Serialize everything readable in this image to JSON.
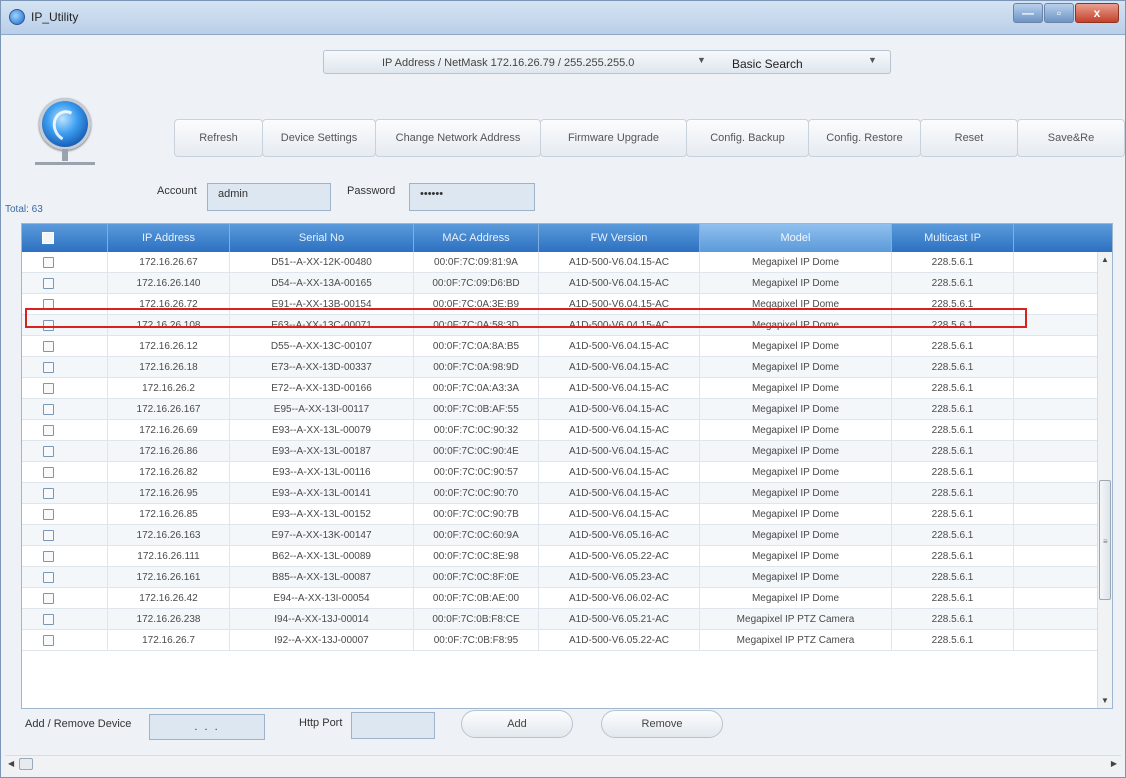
{
  "window": {
    "title": "IP_Utility",
    "controls": {
      "minimize": "—",
      "maximize": "▫",
      "close": "x"
    }
  },
  "search": {
    "ip_netmask": "IP Address / NetMask  172.16.26.79 / 255.255.255.0",
    "mode": "Basic Search"
  },
  "toolbar": {
    "buttons": [
      "Refresh",
      "Device Settings",
      "Change Network Address",
      "Firmware Upgrade",
      "Config. Backup",
      "Config. Restore",
      "Reset",
      "Save&Re"
    ]
  },
  "account": {
    "account_label": "Account",
    "account_value": "admin",
    "password_label": "Password",
    "password_value": "••••••"
  },
  "total": "Total: 63",
  "table": {
    "headers": [
      "IP Address",
      "Serial No",
      "MAC Address",
      "FW Version",
      "Model",
      "Multicast IP"
    ],
    "highlighted_row": 3,
    "rows": [
      [
        "172.16.26.67",
        "D51--A-XX-12K-00480",
        "00:0F:7C:09:81:9A",
        "A1D-500-V6.04.15-AC",
        "Megapixel IP Dome",
        "228.5.6.1"
      ],
      [
        "172.16.26.140",
        "D54--A-XX-13A-00165",
        "00:0F:7C:09:D6:BD",
        "A1D-500-V6.04.15-AC",
        "Megapixel IP Dome",
        "228.5.6.1"
      ],
      [
        "172.16.26.72",
        "E91--A-XX-13B-00154",
        "00:0F:7C:0A:3E:B9",
        "A1D-500-V6.04.15-AC",
        "Megapixel IP Dome",
        "228.5.6.1"
      ],
      [
        "172.16.26.108",
        "E63--A-XX-13C-00071",
        "00:0F:7C:0A:58:3D",
        "A1D-500-V6.04.15-AC",
        "Megapixel IP Dome",
        "228.5.6.1"
      ],
      [
        "172.16.26.12",
        "D55--A-XX-13C-00107",
        "00:0F:7C:0A:8A:B5",
        "A1D-500-V6.04.15-AC",
        "Megapixel IP Dome",
        "228.5.6.1"
      ],
      [
        "172.16.26.18",
        "E73--A-XX-13D-00337",
        "00:0F:7C:0A:98:9D",
        "A1D-500-V6.04.15-AC",
        "Megapixel IP Dome",
        "228.5.6.1"
      ],
      [
        "172.16.26.2",
        "E72--A-XX-13D-00166",
        "00:0F:7C:0A:A3:3A",
        "A1D-500-V6.04.15-AC",
        "Megapixel IP Dome",
        "228.5.6.1"
      ],
      [
        "172.16.26.167",
        "E95--A-XX-13I-00117",
        "00:0F:7C:0B:AF:55",
        "A1D-500-V6.04.15-AC",
        "Megapixel IP Dome",
        "228.5.6.1"
      ],
      [
        "172.16.26.69",
        "E93--A-XX-13L-00079",
        "00:0F:7C:0C:90:32",
        "A1D-500-V6.04.15-AC",
        "Megapixel IP Dome",
        "228.5.6.1"
      ],
      [
        "172.16.26.86",
        "E93--A-XX-13L-00187",
        "00:0F:7C:0C:90:4E",
        "A1D-500-V6.04.15-AC",
        "Megapixel IP Dome",
        "228.5.6.1"
      ],
      [
        "172.16.26.82",
        "E93--A-XX-13L-00116",
        "00:0F:7C:0C:90:57",
        "A1D-500-V6.04.15-AC",
        "Megapixel IP Dome",
        "228.5.6.1"
      ],
      [
        "172.16.26.95",
        "E93--A-XX-13L-00141",
        "00:0F:7C:0C:90:70",
        "A1D-500-V6.04.15-AC",
        "Megapixel IP Dome",
        "228.5.6.1"
      ],
      [
        "172.16.26.85",
        "E93--A-XX-13L-00152",
        "00:0F:7C:0C:90:7B",
        "A1D-500-V6.04.15-AC",
        "Megapixel IP Dome",
        "228.5.6.1"
      ],
      [
        "172.16.26.163",
        "E97--A-XX-13K-00147",
        "00:0F:7C:0C:60:9A",
        "A1D-500-V6.05.16-AC",
        "Megapixel IP Dome",
        "228.5.6.1"
      ],
      [
        "172.16.26.111",
        "B62--A-XX-13L-00089",
        "00:0F:7C:0C:8E:98",
        "A1D-500-V6.05.22-AC",
        "Megapixel IP Dome",
        "228.5.6.1"
      ],
      [
        "172.16.26.161",
        "B85--A-XX-13L-00087",
        "00:0F:7C:0C:8F:0E",
        "A1D-500-V6.05.23-AC",
        "Megapixel IP Dome",
        "228.5.6.1"
      ],
      [
        "172.16.26.42",
        "E94--A-XX-13I-00054",
        "00:0F:7C:0B:AE:00",
        "A1D-500-V6.06.02-AC",
        "Megapixel IP Dome",
        "228.5.6.1"
      ],
      [
        "172.16.26.238",
        "I94--A-XX-13J-00014",
        "00:0F:7C:0B:F8:CE",
        "A1D-500-V6.05.21-AC",
        "Megapixel IP PTZ Camera",
        "228.5.6.1"
      ],
      [
        "172.16.26.7",
        "I92--A-XX-13J-00007",
        "00:0F:7C:0B:F8:95",
        "A1D-500-V6.05.22-AC",
        "Megapixel IP PTZ Camera",
        "228.5.6.1"
      ]
    ]
  },
  "bottom": {
    "add_remove_label": "Add / Remove Device",
    "ip_placeholder": ".   .   .",
    "http_port_label": "Http Port",
    "add_label": "Add",
    "remove_label": "Remove"
  },
  "colors": {
    "header_blue": "#2c70c0",
    "highlight_red": "#d9221d",
    "field_bg": "#dde7f1"
  },
  "icons": {
    "app": "globe-icon",
    "logo": "network-globe-icon",
    "dropdown": "triangle-down-icon"
  }
}
